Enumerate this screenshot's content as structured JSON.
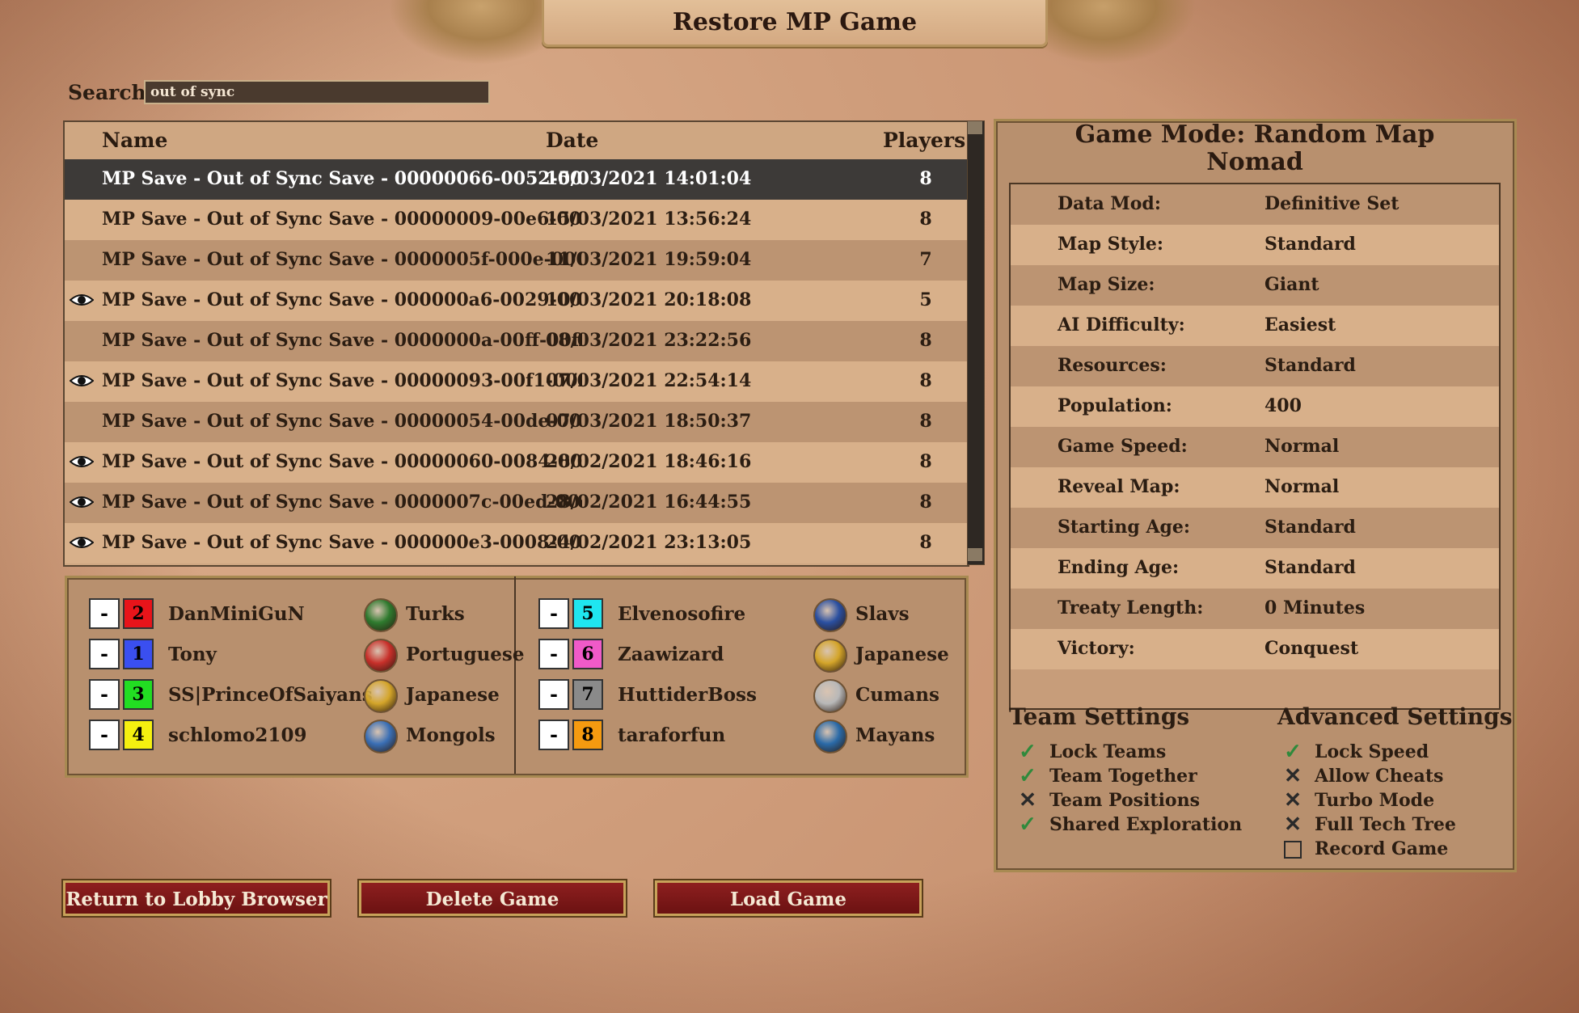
{
  "window": {
    "title": "Restore MP Game"
  },
  "search": {
    "label": "Search",
    "value": "out of sync"
  },
  "saves": {
    "headers": {
      "name": "Name",
      "date": "Date",
      "players": "Players"
    },
    "rows": [
      {
        "name": "MP Save - Out of Sync Save - 00000066-0052-005",
        "date": "15/03/2021 14:01:04",
        "players": "8",
        "eye": false,
        "selected": true
      },
      {
        "name": "MP Save - Out of Sync Save - 00000009-00e6-00e",
        "date": "15/03/2021 13:56:24",
        "players": "8",
        "eye": false
      },
      {
        "name": "MP Save - Out of Sync Save - 0000005f-000e-000",
        "date": "11/03/2021 19:59:04",
        "players": "7",
        "eye": false
      },
      {
        "name": "MP Save - Out of Sync Save - 000000a6-0029-002",
        "date": "10/03/2021 20:18:08",
        "players": "5",
        "eye": true
      },
      {
        "name": "MP Save - Out of Sync Save - 0000000a-00ff-00ff",
        "date": "08/03/2021 23:22:56",
        "players": "8",
        "eye": false
      },
      {
        "name": "MP Save - Out of Sync Save - 00000093-00f1-00f",
        "date": "07/03/2021 22:54:14",
        "players": "8",
        "eye": true
      },
      {
        "name": "MP Save - Out of Sync Save - 00000054-00de-00c",
        "date": "07/03/2021 18:50:37",
        "players": "8",
        "eye": false
      },
      {
        "name": "MP Save - Out of Sync Save - 00000060-0084-008",
        "date": "28/02/2021 18:46:16",
        "players": "8",
        "eye": true
      },
      {
        "name": "MP Save - Out of Sync Save - 0000007c-00ed-00e",
        "date": "28/02/2021 16:44:55",
        "players": "8",
        "eye": true
      },
      {
        "name": "MP Save - Out of Sync Save - 000000e3-0008-000",
        "date": "24/02/2021 23:13:05",
        "players": "8",
        "eye": true
      }
    ]
  },
  "players": [
    {
      "minus": "-",
      "num": "2",
      "color": "#e8141a",
      "name": "DanMiniGuN",
      "civ": "Turks",
      "icon": "turks-emblem-icon",
      "icon_color": "#2e7a2e"
    },
    {
      "minus": "-",
      "num": "1",
      "color": "#3a4ff0",
      "name": "Tony",
      "civ": "Portuguese",
      "icon": "portuguese-emblem-icon",
      "icon_color": "#c8302a"
    },
    {
      "minus": "-",
      "num": "3",
      "color": "#22dd22",
      "name": "SS|PrinceOfSaiyans",
      "civ": "Japanese",
      "icon": "japanese-emblem-icon",
      "icon_color": "#d4a52a"
    },
    {
      "minus": "-",
      "num": "4",
      "color": "#f5f010",
      "name": "schlomo2109",
      "civ": "Mongols",
      "icon": "mongols-emblem-icon",
      "icon_color": "#3a6fb5"
    },
    {
      "minus": "-",
      "num": "5",
      "color": "#1fe6f0",
      "name": "Elvenosofire",
      "civ": "Slavs",
      "icon": "slavs-emblem-icon",
      "icon_color": "#2a4fa0"
    },
    {
      "minus": "-",
      "num": "6",
      "color": "#f05ac8",
      "name": "Zaawizard",
      "civ": "Japanese",
      "icon": "japanese-emblem-icon",
      "icon_color": "#d4a52a"
    },
    {
      "minus": "-",
      "num": "7",
      "color": "#8a8a8a",
      "name": "HuttiderBoss",
      "civ": "Cumans",
      "icon": "cumans-emblem-icon",
      "icon_color": "#b8b8b8"
    },
    {
      "minus": "-",
      "num": "8",
      "color": "#f59a10",
      "name": "taraforfun",
      "civ": "Mayans",
      "icon": "mayans-emblem-icon",
      "icon_color": "#2a6aa8"
    }
  ],
  "game_mode": {
    "title_line1": "Game Mode: Random Map",
    "title_line2": "Nomad",
    "settings": [
      {
        "key": "Data Mod:",
        "value": "Definitive Set"
      },
      {
        "key": "Map Style:",
        "value": "Standard"
      },
      {
        "key": "Map Size:",
        "value": "Giant"
      },
      {
        "key": "AI Difficulty:",
        "value": "Easiest"
      },
      {
        "key": "Resources:",
        "value": "Standard"
      },
      {
        "key": "Population:",
        "value": "400"
      },
      {
        "key": "Game Speed:",
        "value": "Normal"
      },
      {
        "key": "Reveal Map:",
        "value": "Normal"
      },
      {
        "key": "Starting Age:",
        "value": "Standard"
      },
      {
        "key": "Ending Age:",
        "value": "Standard"
      },
      {
        "key": "Treaty Length:",
        "value": "0 Minutes"
      },
      {
        "key": "Victory:",
        "value": "Conquest"
      }
    ]
  },
  "team_settings": {
    "title": "Team Settings",
    "options": [
      {
        "label": "Lock Teams",
        "state": "check"
      },
      {
        "label": "Team Together",
        "state": "check"
      },
      {
        "label": "Team Positions",
        "state": "cross"
      },
      {
        "label": "Shared Exploration",
        "state": "check"
      }
    ]
  },
  "advanced_settings": {
    "title": "Advanced Settings",
    "options": [
      {
        "label": "Lock Speed",
        "state": "check"
      },
      {
        "label": "Allow Cheats",
        "state": "cross"
      },
      {
        "label": "Turbo Mode",
        "state": "cross"
      },
      {
        "label": "Full Tech Tree",
        "state": "cross"
      },
      {
        "label": "Record Game",
        "state": "box"
      }
    ]
  },
  "buttons": {
    "return": "Return to Lobby Browser",
    "delete": "Delete Game",
    "load": "Load Game"
  }
}
